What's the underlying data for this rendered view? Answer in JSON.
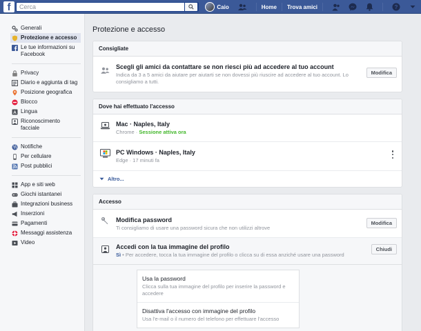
{
  "topbar": {
    "logo": "f",
    "search_placeholder": "Cerca",
    "user_name": "Caio",
    "home": "Home",
    "find_friends": "Trova amici"
  },
  "leftnav": {
    "groups": [
      [
        {
          "label": "Generali",
          "icon": "gear-icon"
        },
        {
          "label": "Protezione e accesso",
          "icon": "shield-icon",
          "active": true
        },
        {
          "label": "Le tue informazioni su Facebook",
          "icon": "facebook-icon"
        }
      ],
      [
        {
          "label": "Privacy",
          "icon": "lock-icon"
        },
        {
          "label": "Diario e aggiunta di tag",
          "icon": "timeline-icon"
        },
        {
          "label": "Posizione geografica",
          "icon": "location-icon"
        },
        {
          "label": "Blocco",
          "icon": "block-icon"
        },
        {
          "label": "Lingua",
          "icon": "language-icon"
        },
        {
          "label": "Riconoscimento facciale",
          "icon": "face-icon"
        }
      ],
      [
        {
          "label": "Notifiche",
          "icon": "globe-icon"
        },
        {
          "label": "Per cellulare",
          "icon": "mobile-icon"
        },
        {
          "label": "Post pubblici",
          "icon": "rss-icon"
        }
      ],
      [
        {
          "label": "App e siti web",
          "icon": "apps-icon"
        },
        {
          "label": "Giochi istantanei",
          "icon": "games-icon"
        },
        {
          "label": "Integrazioni business",
          "icon": "business-icon"
        },
        {
          "label": "Inserzioni",
          "icon": "ads-icon"
        },
        {
          "label": "Pagamenti",
          "icon": "payments-icon"
        },
        {
          "label": "Messaggi assistenza",
          "icon": "support-icon"
        },
        {
          "label": "Video",
          "icon": "video-icon"
        }
      ]
    ]
  },
  "main": {
    "title": "Protezione e accesso",
    "consigliate": {
      "header": "Consigliate",
      "title": "Scegli gli amici da contattare se non riesci più ad accedere al tuo account",
      "subtitle": "Indica da 3 a 5 amici da aiutare per aiutarti se non dovessi più riuscire ad accedere al tuo account. Lo consigliamo a tutti.",
      "button": "Modifica"
    },
    "sessions": {
      "header": "Dove hai effettuato l'accesso",
      "items": [
        {
          "title": "Mac · Naples, Italy",
          "browser": "Chrome · ",
          "status": "Sessione attiva ora"
        },
        {
          "title": "PC Windows · Naples, Italy",
          "browser": "Edge · 17 minuti fa",
          "status": ""
        }
      ],
      "more": "Altro..."
    },
    "access": {
      "header": "Accesso",
      "password_title": "Modifica password",
      "password_sub": "Ti consigliamo di usare una password sicura che non utilizzi altrove",
      "password_button": "Modifica",
      "profile_title": "Accedi con la tua immagine del profilo",
      "profile_yes": "Sì",
      "profile_sub": " • Per accedere, tocca la tua immagine del profilo o clicca su di essa anziché usare una password",
      "profile_button": "Chiudi",
      "options": [
        {
          "title": "Usa la password",
          "sub": "Clicca sulla tua immagine del profilo per inserire la password e accedere"
        },
        {
          "title": "Disattiva l'accesso con immagine del profilo",
          "sub": "Usa l'e-mail o il numero del telefono per effettuare l'accesso"
        }
      ]
    }
  }
}
